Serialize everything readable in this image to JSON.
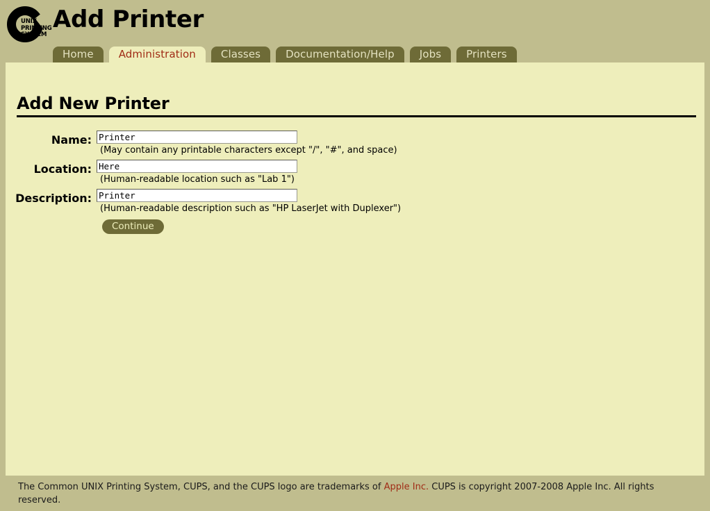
{
  "header": {
    "title": "Add Printer",
    "logo": {
      "name": "cups-logo",
      "line1": "UNIX",
      "line2": "PRINTING",
      "line3": "SYSTEM"
    }
  },
  "tabs": [
    {
      "label": "Home",
      "active": false
    },
    {
      "label": "Administration",
      "active": true
    },
    {
      "label": "Classes",
      "active": false
    },
    {
      "label": "Documentation/Help",
      "active": false
    },
    {
      "label": "Jobs",
      "active": false
    },
    {
      "label": "Printers",
      "active": false
    }
  ],
  "main": {
    "section_title": "Add New Printer",
    "fields": [
      {
        "label": "Name:",
        "value": "Printer",
        "hint": "(May contain any printable characters except \"/\", \"#\", and space)"
      },
      {
        "label": "Location:",
        "value": "Here",
        "hint": "(Human-readable location such as \"Lab 1\")"
      },
      {
        "label": "Description:",
        "value": "Printer",
        "hint": "(Human-readable description such as \"HP LaserJet with Duplexer\")"
      }
    ],
    "submit_label": "Continue"
  },
  "footer": {
    "text_before": "The Common UNIX Printing System, CUPS, and the CUPS logo are trademarks of ",
    "link": "Apple Inc.",
    "text_after": " CUPS is copyright 2007-2008 Apple Inc. All rights reserved."
  },
  "colors": {
    "header_bg": "#c0bd8e",
    "content_bg": "#eeeebb",
    "tab_bg": "#6e6b37",
    "accent": "#a02c16"
  }
}
